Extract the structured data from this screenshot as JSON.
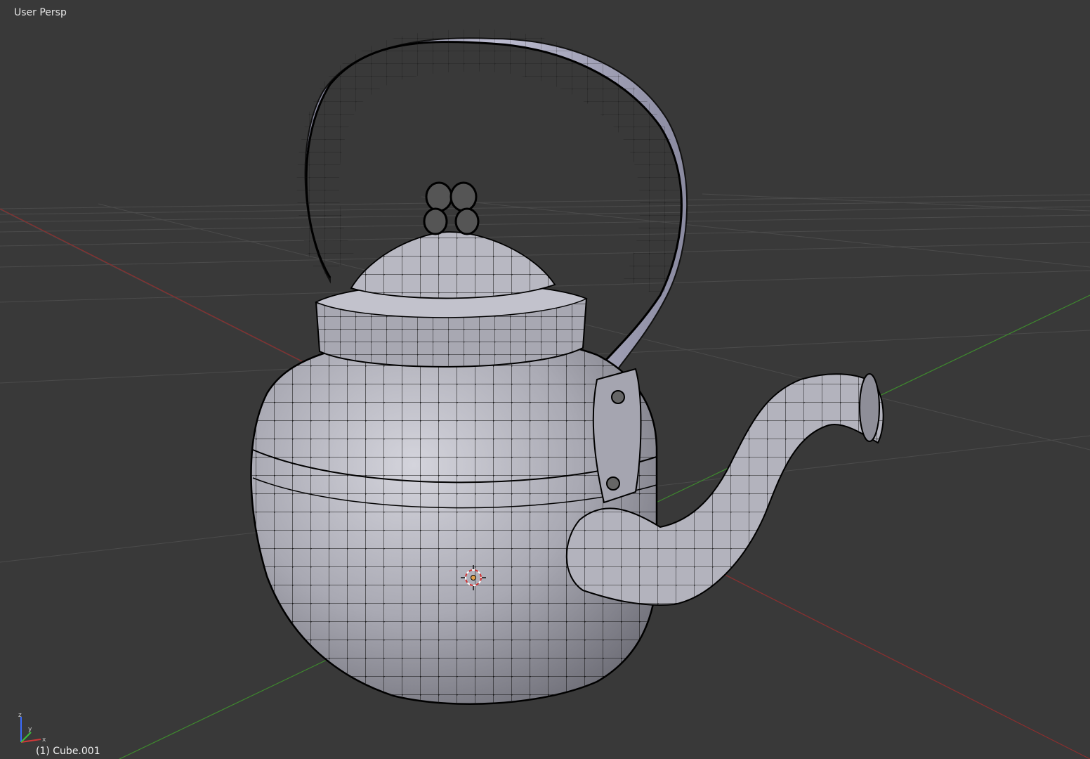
{
  "viewport": {
    "view_label": "User Persp",
    "object_label": "(1) Cube.001",
    "background": "#393939",
    "grid_color": "#4b4b4b",
    "x_axis_color": "#8b2d2d",
    "y_axis_color": "#3e8a2e",
    "mesh_fill": "#b3b3bd",
    "wire_color": "#0a0a0a"
  },
  "gizmo": {
    "axes": [
      "x",
      "y",
      "z"
    ],
    "x_color": "#d03838",
    "y_color": "#3bbf3b",
    "z_color": "#3a6cff"
  },
  "scene_objects": [
    "teapot-body",
    "teapot-lid",
    "teapot-handle",
    "teapot-spout",
    "teapot-knob",
    "3d-cursor"
  ]
}
